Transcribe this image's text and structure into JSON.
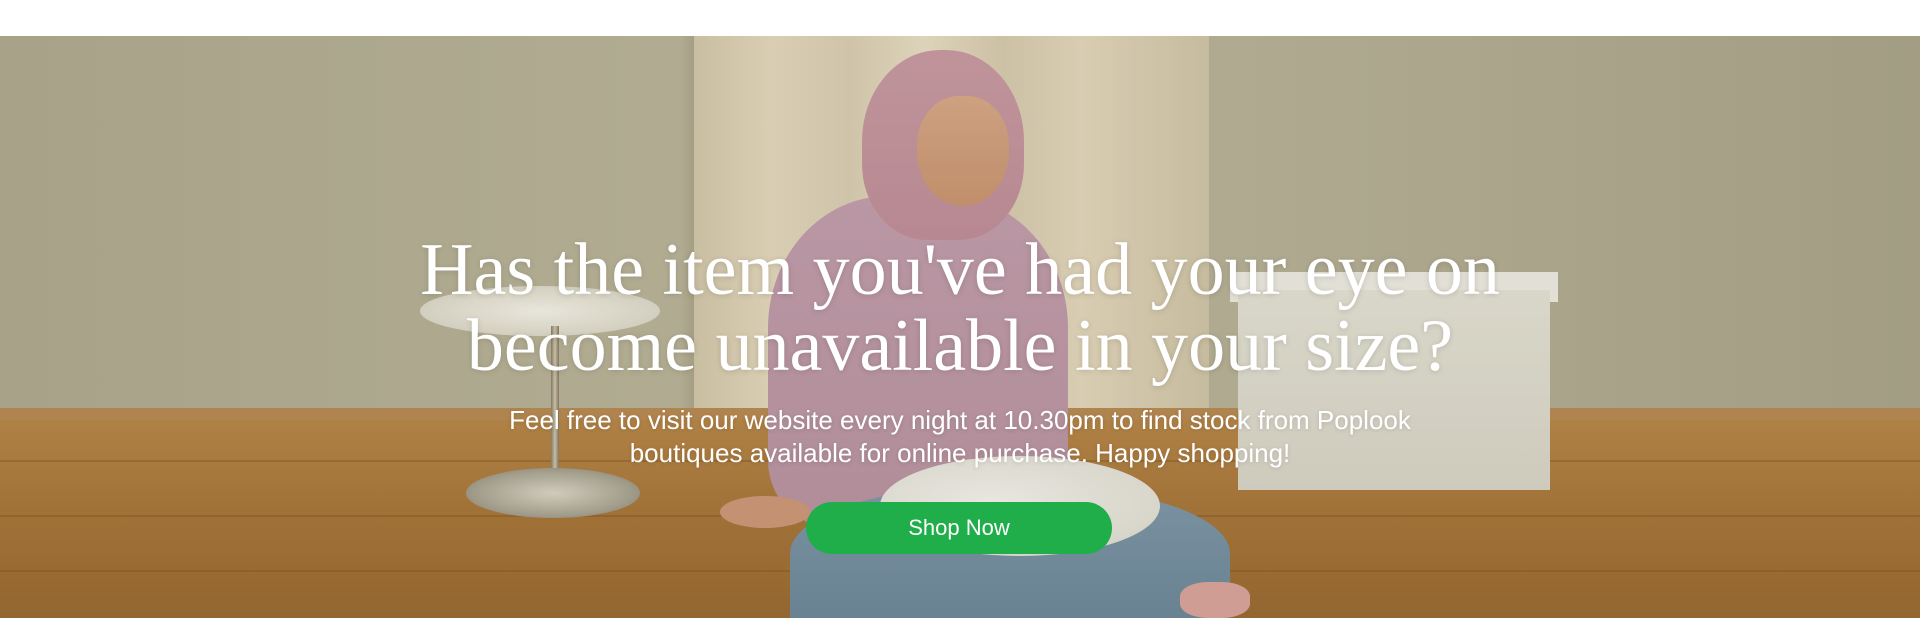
{
  "hero": {
    "headline_line1": "Has the item you've had your eye on",
    "headline_line2": "become unavailable in your size?",
    "subtext_line1": "Feel free to visit our website every night at 10.30pm to find stock from Poplook",
    "subtext_line2": "boutiques available for online purchase. Happy shopping!",
    "button_label": "Shop Now"
  },
  "colors": {
    "button_background": "#1fae4a",
    "text": "#ffffff"
  }
}
